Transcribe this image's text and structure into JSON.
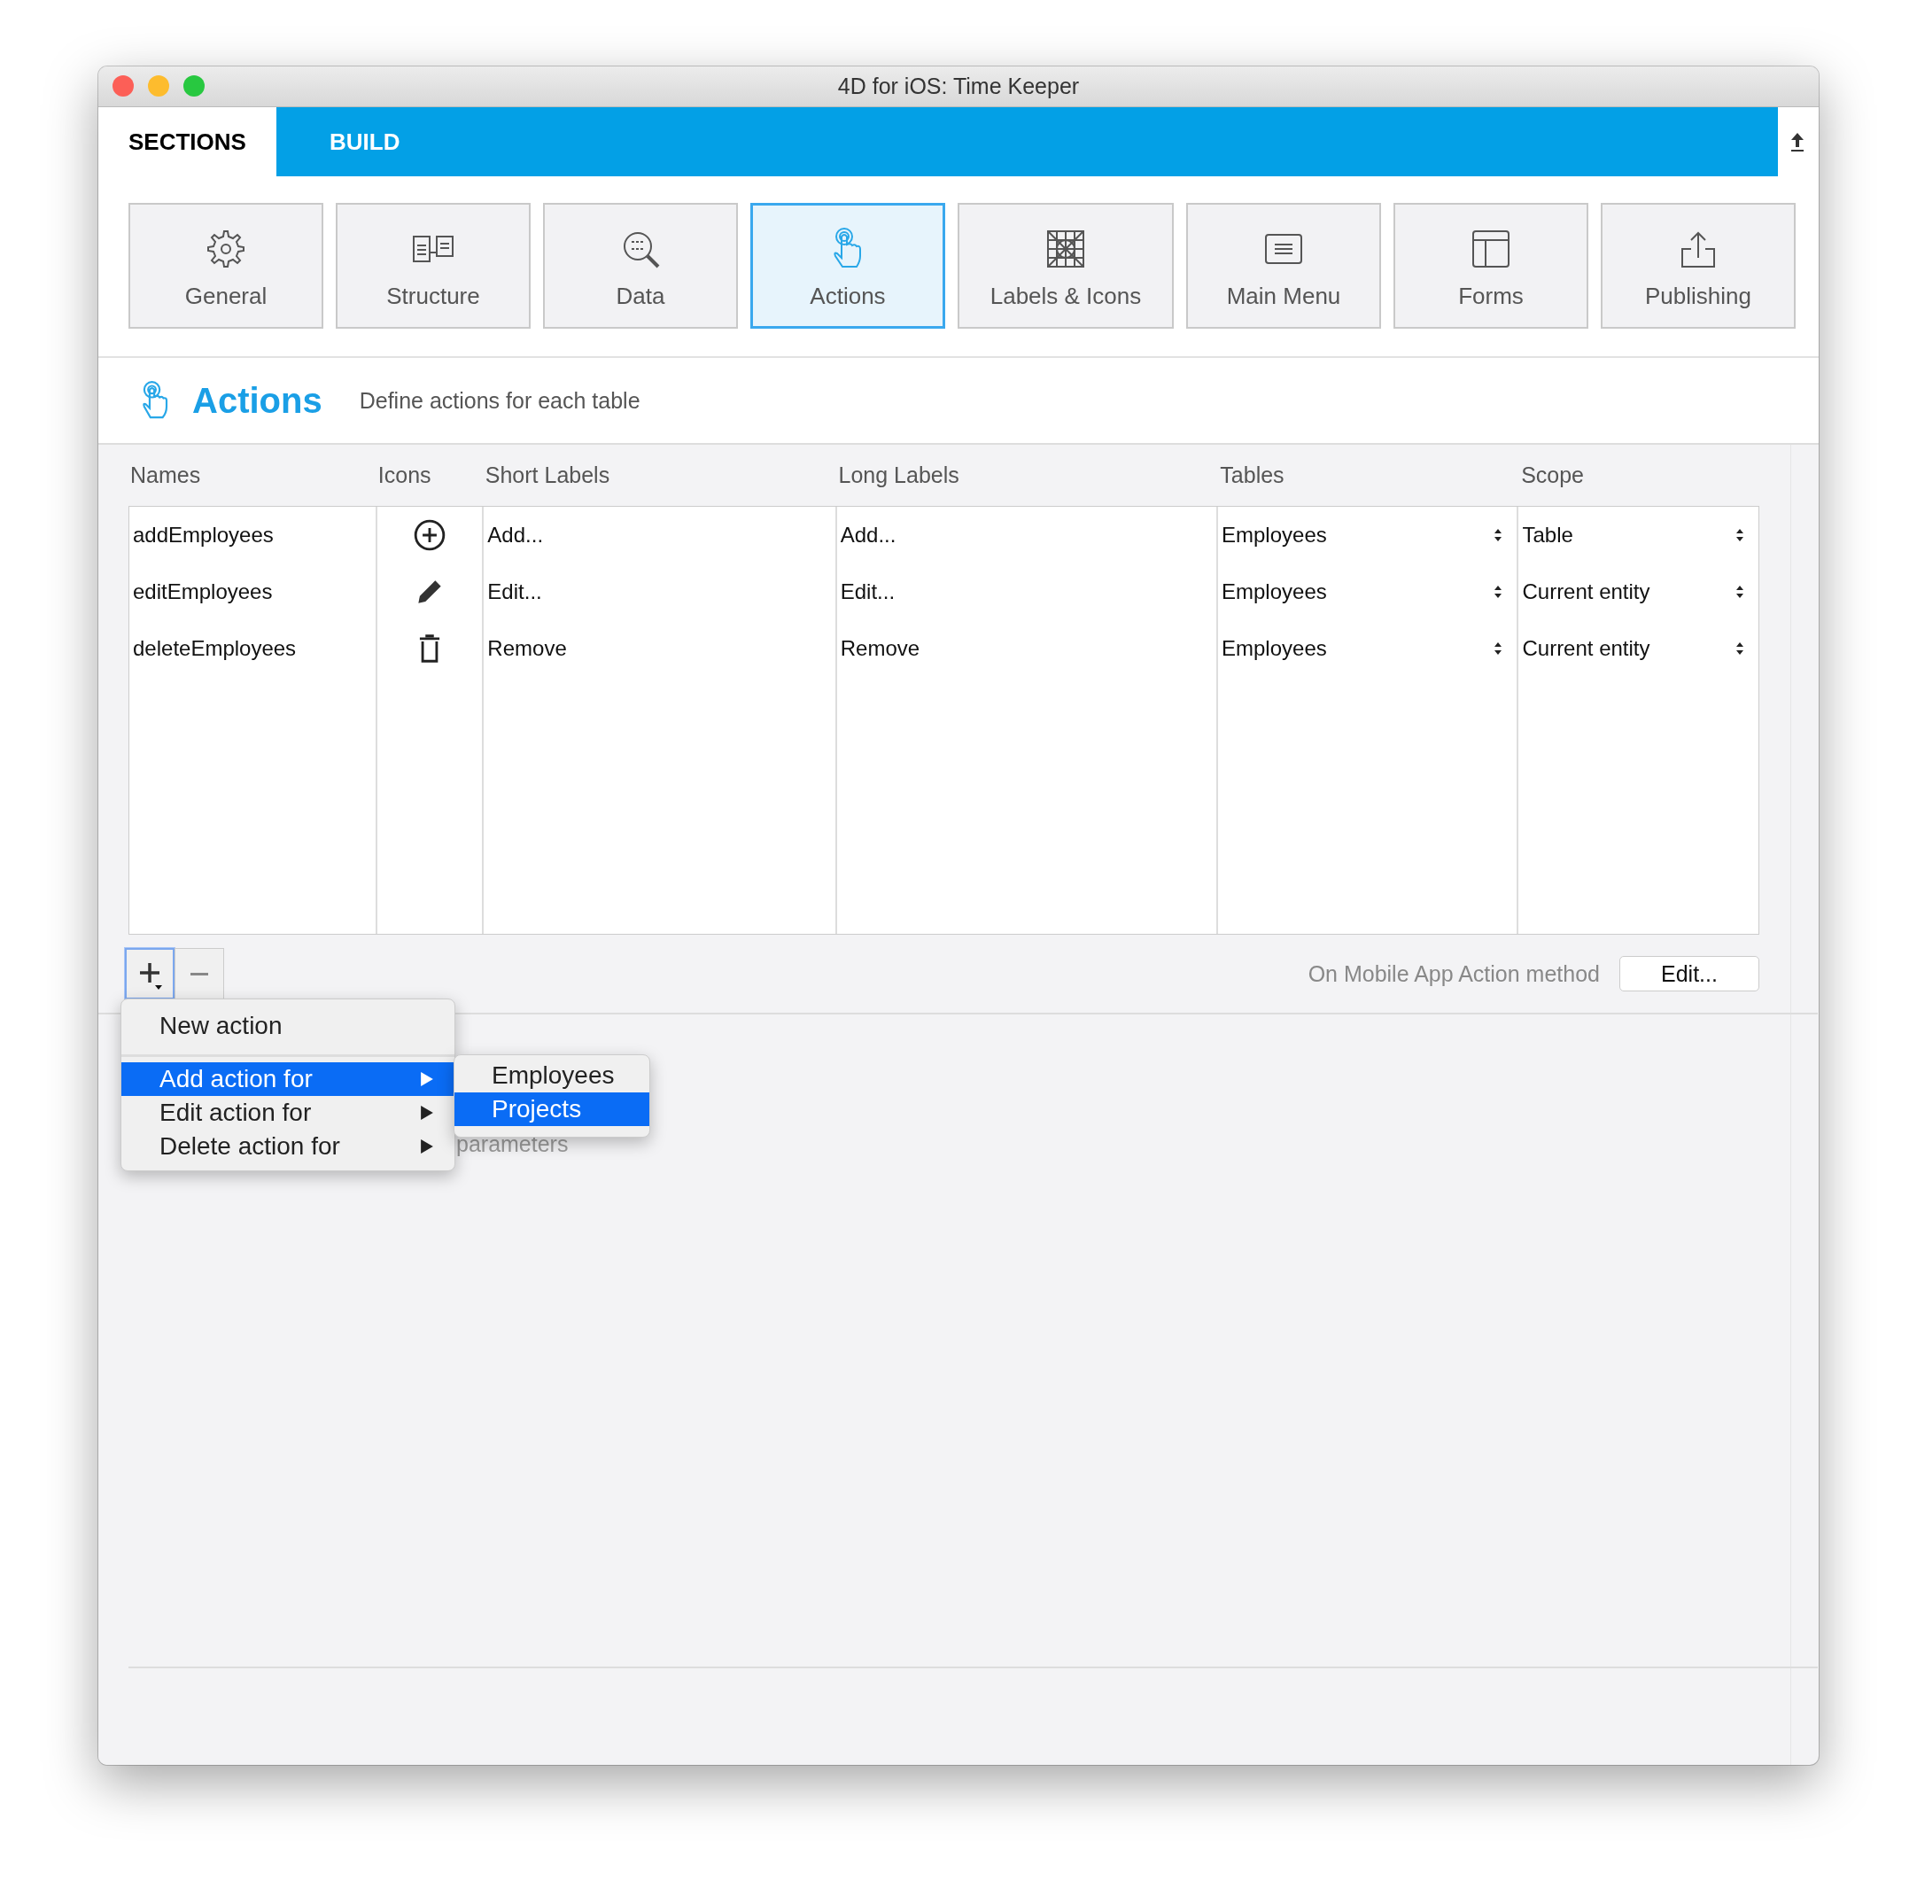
{
  "window": {
    "title": "4D for iOS: Time Keeper"
  },
  "tabs": [
    {
      "label": "SECTIONS",
      "selected": true
    },
    {
      "label": "BUILD",
      "selected": false
    }
  ],
  "sections": [
    {
      "label": "General",
      "selected": false
    },
    {
      "label": "Structure",
      "selected": false
    },
    {
      "label": "Data",
      "selected": false
    },
    {
      "label": "Actions",
      "selected": true
    },
    {
      "label": "Labels & Icons",
      "selected": false
    },
    {
      "label": "Main Menu",
      "selected": false
    },
    {
      "label": "Forms",
      "selected": false
    },
    {
      "label": "Publishing",
      "selected": false
    }
  ],
  "header": {
    "title": "Actions",
    "subtitle": "Define actions for each table"
  },
  "table": {
    "columns": [
      "Names",
      "Icons",
      "Short Labels",
      "Long Labels",
      "Tables",
      "Scope"
    ],
    "rows": [
      {
        "name": "addEmployees",
        "short_label": "Add...",
        "long_label": "Add...",
        "table": "Employees",
        "scope": "Table"
      },
      {
        "name": "editEmployees",
        "short_label": "Edit...",
        "long_label": "Edit...",
        "table": "Employees",
        "scope": "Current entity"
      },
      {
        "name": "deleteEmployees",
        "short_label": "Remove",
        "long_label": "Remove",
        "table": "Employees",
        "scope": "Current entity"
      }
    ]
  },
  "method": {
    "label": "On Mobile App Action method",
    "button": "Edit..."
  },
  "parameters_text": "parameters",
  "menu": [
    {
      "kind": "item",
      "label": "New action",
      "submenu": false,
      "selected": false
    },
    {
      "kind": "separator"
    },
    {
      "kind": "item",
      "label": "Add action for",
      "submenu": true,
      "selected": true
    },
    {
      "kind": "item",
      "label": "Edit action for",
      "submenu": true,
      "selected": false
    },
    {
      "kind": "item",
      "label": "Delete action for",
      "submenu": true,
      "selected": false
    }
  ],
  "submenu": [
    {
      "label": "Employees",
      "selected": false
    },
    {
      "label": "Projects",
      "selected": true
    }
  ]
}
